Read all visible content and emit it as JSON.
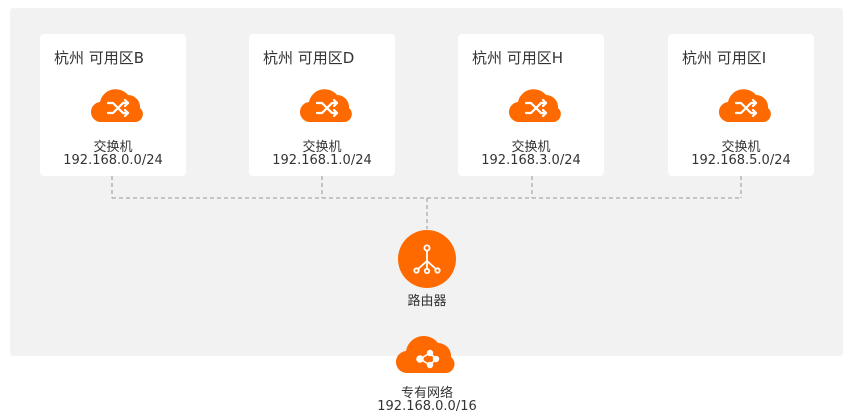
{
  "colors": {
    "accent": "#ff6a00",
    "panel": "#f2f2f2",
    "card": "#ffffff",
    "link": "#aaaaaa"
  },
  "zones": [
    {
      "title": "杭州 可用区B",
      "device": "交换机",
      "cidr": "192.168.0.0/24",
      "icon": "switch-cloud-icon"
    },
    {
      "title": "杭州 可用区D",
      "device": "交换机",
      "cidr": "192.168.1.0/24",
      "icon": "switch-cloud-icon"
    },
    {
      "title": "杭州 可用区H",
      "device": "交换机",
      "cidr": "192.168.3.0/24",
      "icon": "switch-cloud-icon"
    },
    {
      "title": "杭州 可用区I",
      "device": "交换机",
      "cidr": "192.168.5.0/24",
      "icon": "switch-cloud-icon"
    }
  ],
  "router": {
    "label": "路由器",
    "icon": "router-icon"
  },
  "vpc": {
    "name": "专有网络",
    "cidr": "192.168.0.0/16",
    "icon": "vpc-cloud-icon"
  }
}
